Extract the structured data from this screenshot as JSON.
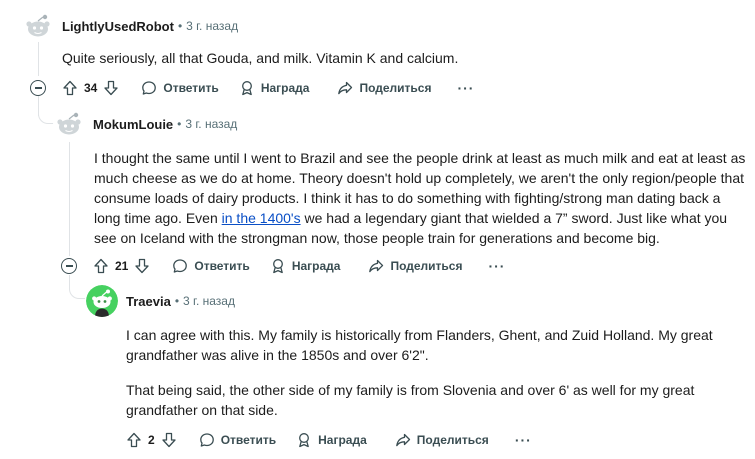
{
  "labels": {
    "reply": "Ответить",
    "award": "Награда",
    "share": "Поделиться",
    "more": "···",
    "separator": "•"
  },
  "comments": [
    {
      "author": "LightlyUsedRobot",
      "time": "3 г. назад",
      "avatar": "snoo-gray",
      "paragraphs": [
        "Quite seriously, all that Gouda, and milk. Vitamin K and calcium."
      ],
      "votes": "34"
    },
    {
      "author": "MokumLouie",
      "time": "3 г. назад",
      "avatar": "snoo-gray",
      "text_before_link": "I thought the same until I went to Brazil and see the people drink at least as much milk and eat at least as much cheese as we do at home. Theory doesn't hold up completely, we aren't the only region/people that consume loads of dairy products. I think it has to do something with fighting/strong man dating back a long time ago. Even ",
      "link_text": "in the 1400's",
      "text_after_link": " we had a legendary giant that wielded a 7” sword. Just like what you see on Iceland with the strongman now, those people train for generations and become big.",
      "votes": "21"
    },
    {
      "author": "Traevia",
      "time": "3 г. назад",
      "avatar": "snoo-green",
      "paragraphs": [
        "I can agree with this. My family is historically from Flanders, Ghent, and Zuid Holland. My great grandfather was alive in the 1850s and over 6'2\".",
        "That being said, the other side of my family is from Slovenia and over 6' as well for my great grandfather on that side."
      ],
      "votes": "2"
    }
  ],
  "colors": {
    "text": "#1c1c1c",
    "meta": "#576f76",
    "action": "#3a4d52",
    "link": "#0a4fc6",
    "thread_line": "#e0e3e6",
    "avatar_green": "#46d160"
  }
}
